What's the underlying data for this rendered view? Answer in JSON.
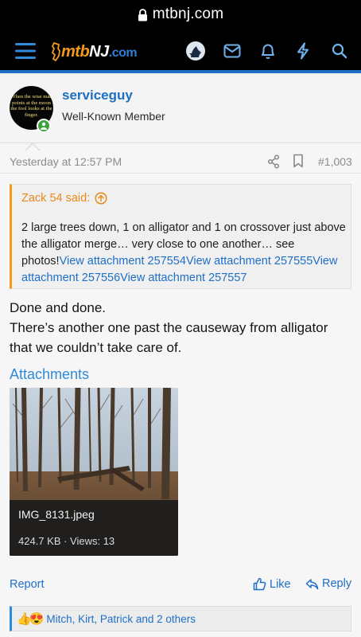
{
  "browser": {
    "url": "mtbnj.com"
  },
  "nav": {
    "logo_parts": [
      "mtb",
      "NJ",
      ".com"
    ],
    "icons": [
      "menu-icon",
      "user-avatar-icon",
      "inbox-icon",
      "bell-icon",
      "bolt-icon",
      "search-icon"
    ]
  },
  "post": {
    "author": {
      "name": "serviceguy",
      "title": "Well-Known Member",
      "avatar_text": "When the wise man\npoints at the moon\nthe fool looks at the\nfinger."
    },
    "timestamp": "Yesterday at 12:57 PM",
    "post_number": "#1,003",
    "quote": {
      "header": "Zack 54 said:",
      "text_before": "2 large trees down, 1 on alligator and 1 on crossover just above the alligator merge… very close to one another… see photos!",
      "links": [
        "View attachment 257554",
        "View attachment 257555",
        "View attachment 257556",
        "View attachment 257557"
      ]
    },
    "body": "Done and done.\nThere’s another one past the causeway from alligator that we couldn’t take care of.",
    "attachments": {
      "title": "Attachments",
      "items": [
        {
          "filename": "IMG_8131.jpeg",
          "meta": "424.7 KB · Views: 13"
        }
      ]
    },
    "actions": {
      "report": "Report",
      "like": "Like",
      "reply": "Reply"
    },
    "reactions": {
      "emojis": [
        "👍",
        "😍"
      ],
      "text": "Mitch, Kirt, Patrick and 2 others"
    }
  },
  "colors": {
    "link": "#1f6fc7",
    "accent_orange": "#f39a1b",
    "nav_bg": "#000000",
    "online": "#3ea33e"
  }
}
